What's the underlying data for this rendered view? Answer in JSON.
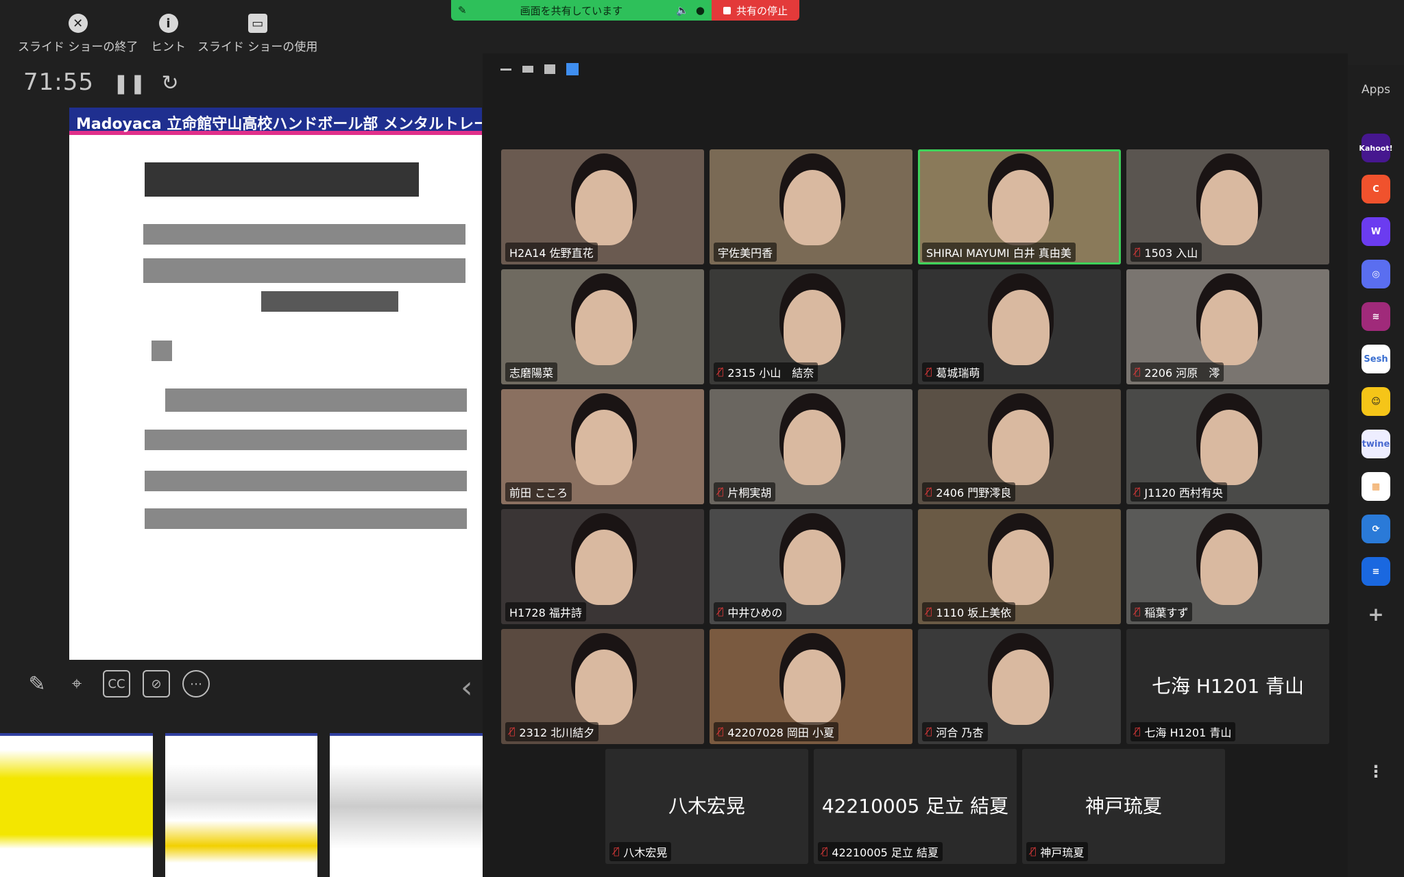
{
  "share_banner": {
    "label": "画面を共有しています",
    "stop": "共有の停止"
  },
  "toolbar": {
    "end_show": "スライド ショーの終了",
    "hint": "ヒント",
    "use_show": "スライド ショーの使用"
  },
  "timer": "71:55",
  "slide": {
    "title": "Madoyaca 立命館守山高校ハンドボール部 メンタルトレー"
  },
  "apps": {
    "label": "Apps",
    "items": [
      "Kahoot!",
      "Sesh",
      "twine"
    ]
  },
  "participants": [
    {
      "name": "H2A14 佐野直花",
      "muted": false
    },
    {
      "name": "宇佐美円香",
      "muted": false
    },
    {
      "name": "SHIRAI MAYUMI 白井 真由美",
      "muted": false,
      "active": true
    },
    {
      "name": "1503 入山",
      "muted": true
    },
    {
      "name": "志磨陽菜",
      "muted": false
    },
    {
      "name": "2315 小山　結奈",
      "muted": true
    },
    {
      "name": "葛城瑞萌",
      "muted": true
    },
    {
      "name": "2206 河原　澪",
      "muted": true
    },
    {
      "name": "前田 こころ",
      "muted": false
    },
    {
      "name": "片桐実胡",
      "muted": true
    },
    {
      "name": "2406 門野澪良",
      "muted": true
    },
    {
      "name": "J1120 西村有央",
      "muted": true
    },
    {
      "name": "H1728 福井詩",
      "muted": false
    },
    {
      "name": "中井ひめの",
      "muted": true
    },
    {
      "name": "1110 坂上美依",
      "muted": true
    },
    {
      "name": "稲葉すず",
      "muted": true
    },
    {
      "name": "2312 北川結夕",
      "muted": true
    },
    {
      "name": "42207028 岡田 小夏",
      "muted": true
    },
    {
      "name": "河合 乃杏",
      "muted": true
    },
    {
      "name": "七海 H1201 青山",
      "muted": true,
      "no_video": true
    },
    {
      "name": "八木宏晃",
      "muted": true,
      "no_video": true
    },
    {
      "name": "42210005 足立 結夏",
      "muted": true,
      "no_video": true
    },
    {
      "name": "神戸琉夏",
      "muted": true,
      "no_video": true
    }
  ]
}
